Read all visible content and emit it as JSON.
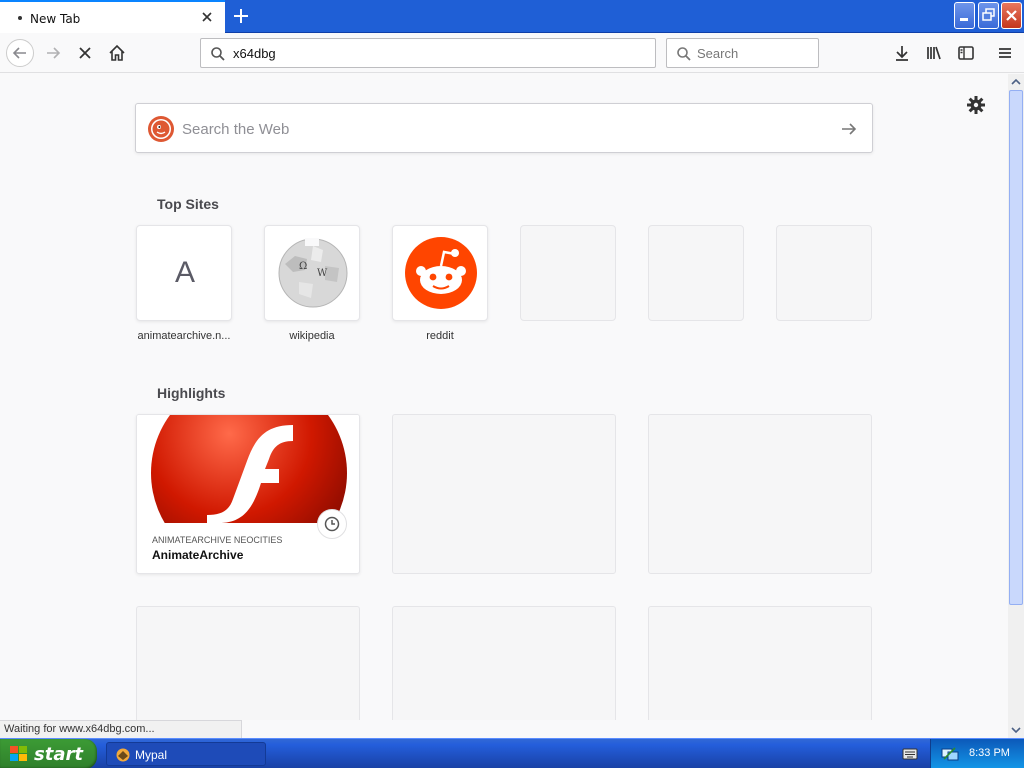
{
  "tab": {
    "title": "New Tab"
  },
  "urlbar": {
    "value": "x64dbg"
  },
  "searchbar": {
    "placeholder": "Search"
  },
  "websearch": {
    "placeholder": "Search the Web"
  },
  "top_sites": {
    "title": "Top Sites",
    "items": [
      {
        "label": "animatearchive.n...",
        "letter": "A"
      },
      {
        "label": "wikipedia"
      },
      {
        "label": "reddit"
      }
    ]
  },
  "highlights": {
    "title": "Highlights",
    "card": {
      "source": "ANIMATEARCHIVE NEOCITIES",
      "title": "AnimateArchive"
    }
  },
  "status": {
    "text": "Waiting for www.x64dbg.com..."
  },
  "taskbar": {
    "start_label": "start",
    "task_label": "Mypal",
    "clock": "8:33 PM"
  },
  "colors": {
    "titlebar": "#1f5fd6",
    "taskbar": "#245edb",
    "start": "#3c9b35",
    "reddit": "#ff4500",
    "flash": "#d01800"
  }
}
